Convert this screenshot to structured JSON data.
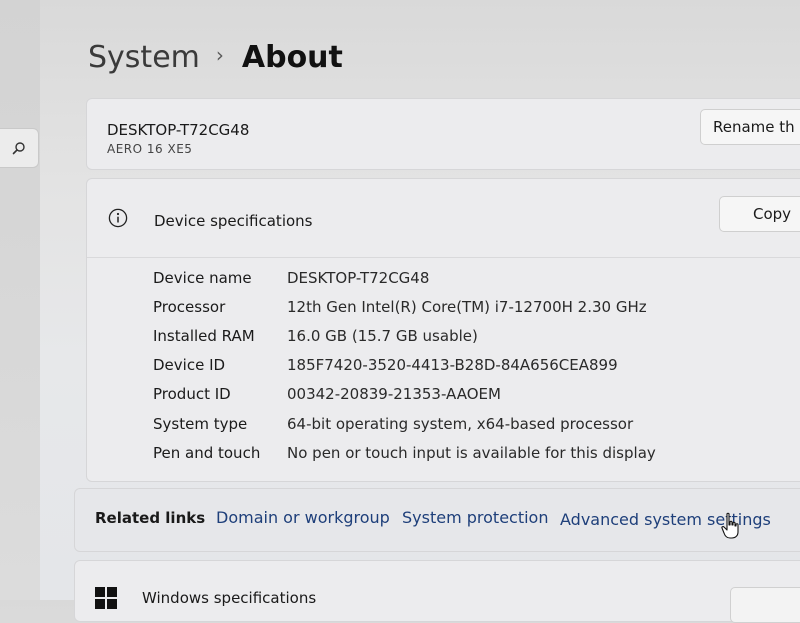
{
  "breadcrumb": {
    "parent": "System",
    "separator": "›",
    "current": "About"
  },
  "device": {
    "name": "DESKTOP-T72CG48",
    "model": "AERO 16 XE5",
    "rename_label": "Rename th"
  },
  "device_specifications": {
    "title": "Device specifications",
    "copy_label": "Copy",
    "rows": [
      {
        "label": "Device name",
        "value": "DESKTOP-T72CG48"
      },
      {
        "label": "Processor",
        "value": "12th Gen Intel(R) Core(TM) i7-12700H   2.30 GHz"
      },
      {
        "label": "Installed RAM",
        "value": "16.0 GB (15.7 GB usable)"
      },
      {
        "label": "Device ID",
        "value": "185F7420-3520-4413-B28D-84A656CEA899"
      },
      {
        "label": "Product ID",
        "value": "00342-20839-21353-AAOEM"
      },
      {
        "label": "System type",
        "value": "64-bit operating system, x64-based processor"
      },
      {
        "label": "Pen and touch",
        "value": "No pen or touch input is available for this display"
      }
    ]
  },
  "related_links": {
    "label": "Related links",
    "links": [
      "Domain or workgroup",
      "System protection",
      "Advanced system settings"
    ]
  },
  "windows_specifications": {
    "title": "Windows specifications"
  },
  "colors": {
    "link": "#1e3f7a",
    "card_bg": "#ececee"
  },
  "icons": {
    "search": "search-icon",
    "info": "info-icon",
    "windows": "windows-logo-icon",
    "cursor": "hand-pointer-icon"
  }
}
